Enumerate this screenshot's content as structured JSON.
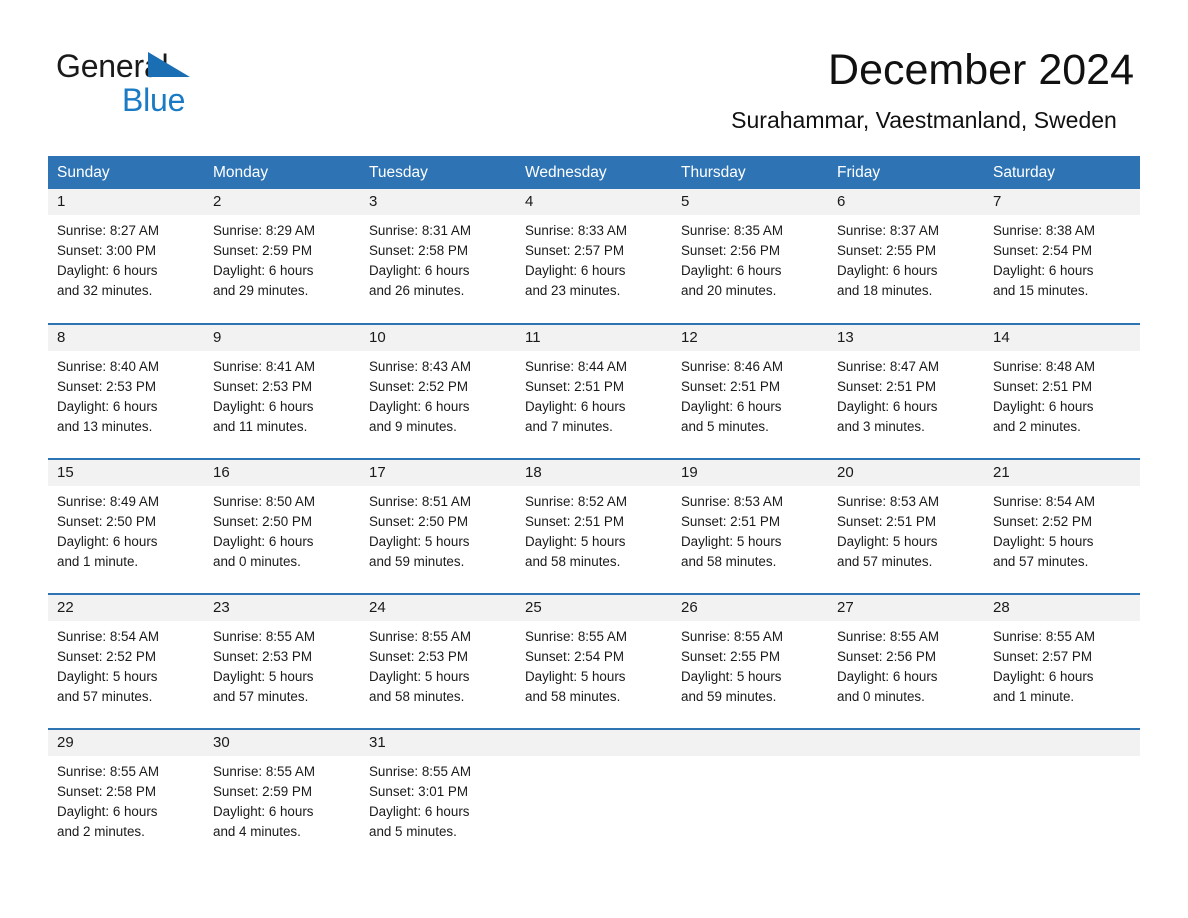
{
  "logo": {
    "word1": "General",
    "word2": "Blue",
    "triangle_color": "#1a6fb4",
    "blue_text_color": "#1a7ac4"
  },
  "header": {
    "title": "December 2024",
    "subtitle": "Surahammar, Vaestmanland, Sweden"
  },
  "theme": {
    "header_blue": "#2e74b5",
    "row_band_gray": "#f2f2f2",
    "text_color": "#1a1a1a"
  },
  "calendar": {
    "day_headers": [
      "Sunday",
      "Monday",
      "Tuesday",
      "Wednesday",
      "Thursday",
      "Friday",
      "Saturday"
    ],
    "weeks": [
      [
        {
          "day": "1",
          "sunrise": "Sunrise: 8:27 AM",
          "sunset": "Sunset: 3:00 PM",
          "daylight_line1": "Daylight: 6 hours",
          "daylight_line2": "and 32 minutes."
        },
        {
          "day": "2",
          "sunrise": "Sunrise: 8:29 AM",
          "sunset": "Sunset: 2:59 PM",
          "daylight_line1": "Daylight: 6 hours",
          "daylight_line2": "and 29 minutes."
        },
        {
          "day": "3",
          "sunrise": "Sunrise: 8:31 AM",
          "sunset": "Sunset: 2:58 PM",
          "daylight_line1": "Daylight: 6 hours",
          "daylight_line2": "and 26 minutes."
        },
        {
          "day": "4",
          "sunrise": "Sunrise: 8:33 AM",
          "sunset": "Sunset: 2:57 PM",
          "daylight_line1": "Daylight: 6 hours",
          "daylight_line2": "and 23 minutes."
        },
        {
          "day": "5",
          "sunrise": "Sunrise: 8:35 AM",
          "sunset": "Sunset: 2:56 PM",
          "daylight_line1": "Daylight: 6 hours",
          "daylight_line2": "and 20 minutes."
        },
        {
          "day": "6",
          "sunrise": "Sunrise: 8:37 AM",
          "sunset": "Sunset: 2:55 PM",
          "daylight_line1": "Daylight: 6 hours",
          "daylight_line2": "and 18 minutes."
        },
        {
          "day": "7",
          "sunrise": "Sunrise: 8:38 AM",
          "sunset": "Sunset: 2:54 PM",
          "daylight_line1": "Daylight: 6 hours",
          "daylight_line2": "and 15 minutes."
        }
      ],
      [
        {
          "day": "8",
          "sunrise": "Sunrise: 8:40 AM",
          "sunset": "Sunset: 2:53 PM",
          "daylight_line1": "Daylight: 6 hours",
          "daylight_line2": "and 13 minutes."
        },
        {
          "day": "9",
          "sunrise": "Sunrise: 8:41 AM",
          "sunset": "Sunset: 2:53 PM",
          "daylight_line1": "Daylight: 6 hours",
          "daylight_line2": "and 11 minutes."
        },
        {
          "day": "10",
          "sunrise": "Sunrise: 8:43 AM",
          "sunset": "Sunset: 2:52 PM",
          "daylight_line1": "Daylight: 6 hours",
          "daylight_line2": "and 9 minutes."
        },
        {
          "day": "11",
          "sunrise": "Sunrise: 8:44 AM",
          "sunset": "Sunset: 2:51 PM",
          "daylight_line1": "Daylight: 6 hours",
          "daylight_line2": "and 7 minutes."
        },
        {
          "day": "12",
          "sunrise": "Sunrise: 8:46 AM",
          "sunset": "Sunset: 2:51 PM",
          "daylight_line1": "Daylight: 6 hours",
          "daylight_line2": "and 5 minutes."
        },
        {
          "day": "13",
          "sunrise": "Sunrise: 8:47 AM",
          "sunset": "Sunset: 2:51 PM",
          "daylight_line1": "Daylight: 6 hours",
          "daylight_line2": "and 3 minutes."
        },
        {
          "day": "14",
          "sunrise": "Sunrise: 8:48 AM",
          "sunset": "Sunset: 2:51 PM",
          "daylight_line1": "Daylight: 6 hours",
          "daylight_line2": "and 2 minutes."
        }
      ],
      [
        {
          "day": "15",
          "sunrise": "Sunrise: 8:49 AM",
          "sunset": "Sunset: 2:50 PM",
          "daylight_line1": "Daylight: 6 hours",
          "daylight_line2": "and 1 minute."
        },
        {
          "day": "16",
          "sunrise": "Sunrise: 8:50 AM",
          "sunset": "Sunset: 2:50 PM",
          "daylight_line1": "Daylight: 6 hours",
          "daylight_line2": "and 0 minutes."
        },
        {
          "day": "17",
          "sunrise": "Sunrise: 8:51 AM",
          "sunset": "Sunset: 2:50 PM",
          "daylight_line1": "Daylight: 5 hours",
          "daylight_line2": "and 59 minutes."
        },
        {
          "day": "18",
          "sunrise": "Sunrise: 8:52 AM",
          "sunset": "Sunset: 2:51 PM",
          "daylight_line1": "Daylight: 5 hours",
          "daylight_line2": "and 58 minutes."
        },
        {
          "day": "19",
          "sunrise": "Sunrise: 8:53 AM",
          "sunset": "Sunset: 2:51 PM",
          "daylight_line1": "Daylight: 5 hours",
          "daylight_line2": "and 58 minutes."
        },
        {
          "day": "20",
          "sunrise": "Sunrise: 8:53 AM",
          "sunset": "Sunset: 2:51 PM",
          "daylight_line1": "Daylight: 5 hours",
          "daylight_line2": "and 57 minutes."
        },
        {
          "day": "21",
          "sunrise": "Sunrise: 8:54 AM",
          "sunset": "Sunset: 2:52 PM",
          "daylight_line1": "Daylight: 5 hours",
          "daylight_line2": "and 57 minutes."
        }
      ],
      [
        {
          "day": "22",
          "sunrise": "Sunrise: 8:54 AM",
          "sunset": "Sunset: 2:52 PM",
          "daylight_line1": "Daylight: 5 hours",
          "daylight_line2": "and 57 minutes."
        },
        {
          "day": "23",
          "sunrise": "Sunrise: 8:55 AM",
          "sunset": "Sunset: 2:53 PM",
          "daylight_line1": "Daylight: 5 hours",
          "daylight_line2": "and 57 minutes."
        },
        {
          "day": "24",
          "sunrise": "Sunrise: 8:55 AM",
          "sunset": "Sunset: 2:53 PM",
          "daylight_line1": "Daylight: 5 hours",
          "daylight_line2": "and 58 minutes."
        },
        {
          "day": "25",
          "sunrise": "Sunrise: 8:55 AM",
          "sunset": "Sunset: 2:54 PM",
          "daylight_line1": "Daylight: 5 hours",
          "daylight_line2": "and 58 minutes."
        },
        {
          "day": "26",
          "sunrise": "Sunrise: 8:55 AM",
          "sunset": "Sunset: 2:55 PM",
          "daylight_line1": "Daylight: 5 hours",
          "daylight_line2": "and 59 minutes."
        },
        {
          "day": "27",
          "sunrise": "Sunrise: 8:55 AM",
          "sunset": "Sunset: 2:56 PM",
          "daylight_line1": "Daylight: 6 hours",
          "daylight_line2": "and 0 minutes."
        },
        {
          "day": "28",
          "sunrise": "Sunrise: 8:55 AM",
          "sunset": "Sunset: 2:57 PM",
          "daylight_line1": "Daylight: 6 hours",
          "daylight_line2": "and 1 minute."
        }
      ],
      [
        {
          "day": "29",
          "sunrise": "Sunrise: 8:55 AM",
          "sunset": "Sunset: 2:58 PM",
          "daylight_line1": "Daylight: 6 hours",
          "daylight_line2": "and 2 minutes."
        },
        {
          "day": "30",
          "sunrise": "Sunrise: 8:55 AM",
          "sunset": "Sunset: 2:59 PM",
          "daylight_line1": "Daylight: 6 hours",
          "daylight_line2": "and 4 minutes."
        },
        {
          "day": "31",
          "sunrise": "Sunrise: 8:55 AM",
          "sunset": "Sunset: 3:01 PM",
          "daylight_line1": "Daylight: 6 hours",
          "daylight_line2": "and 5 minutes."
        },
        {
          "day": "",
          "sunrise": "",
          "sunset": "",
          "daylight_line1": "",
          "daylight_line2": ""
        },
        {
          "day": "",
          "sunrise": "",
          "sunset": "",
          "daylight_line1": "",
          "daylight_line2": ""
        },
        {
          "day": "",
          "sunrise": "",
          "sunset": "",
          "daylight_line1": "",
          "daylight_line2": ""
        },
        {
          "day": "",
          "sunrise": "",
          "sunset": "",
          "daylight_line1": "",
          "daylight_line2": ""
        }
      ]
    ]
  }
}
